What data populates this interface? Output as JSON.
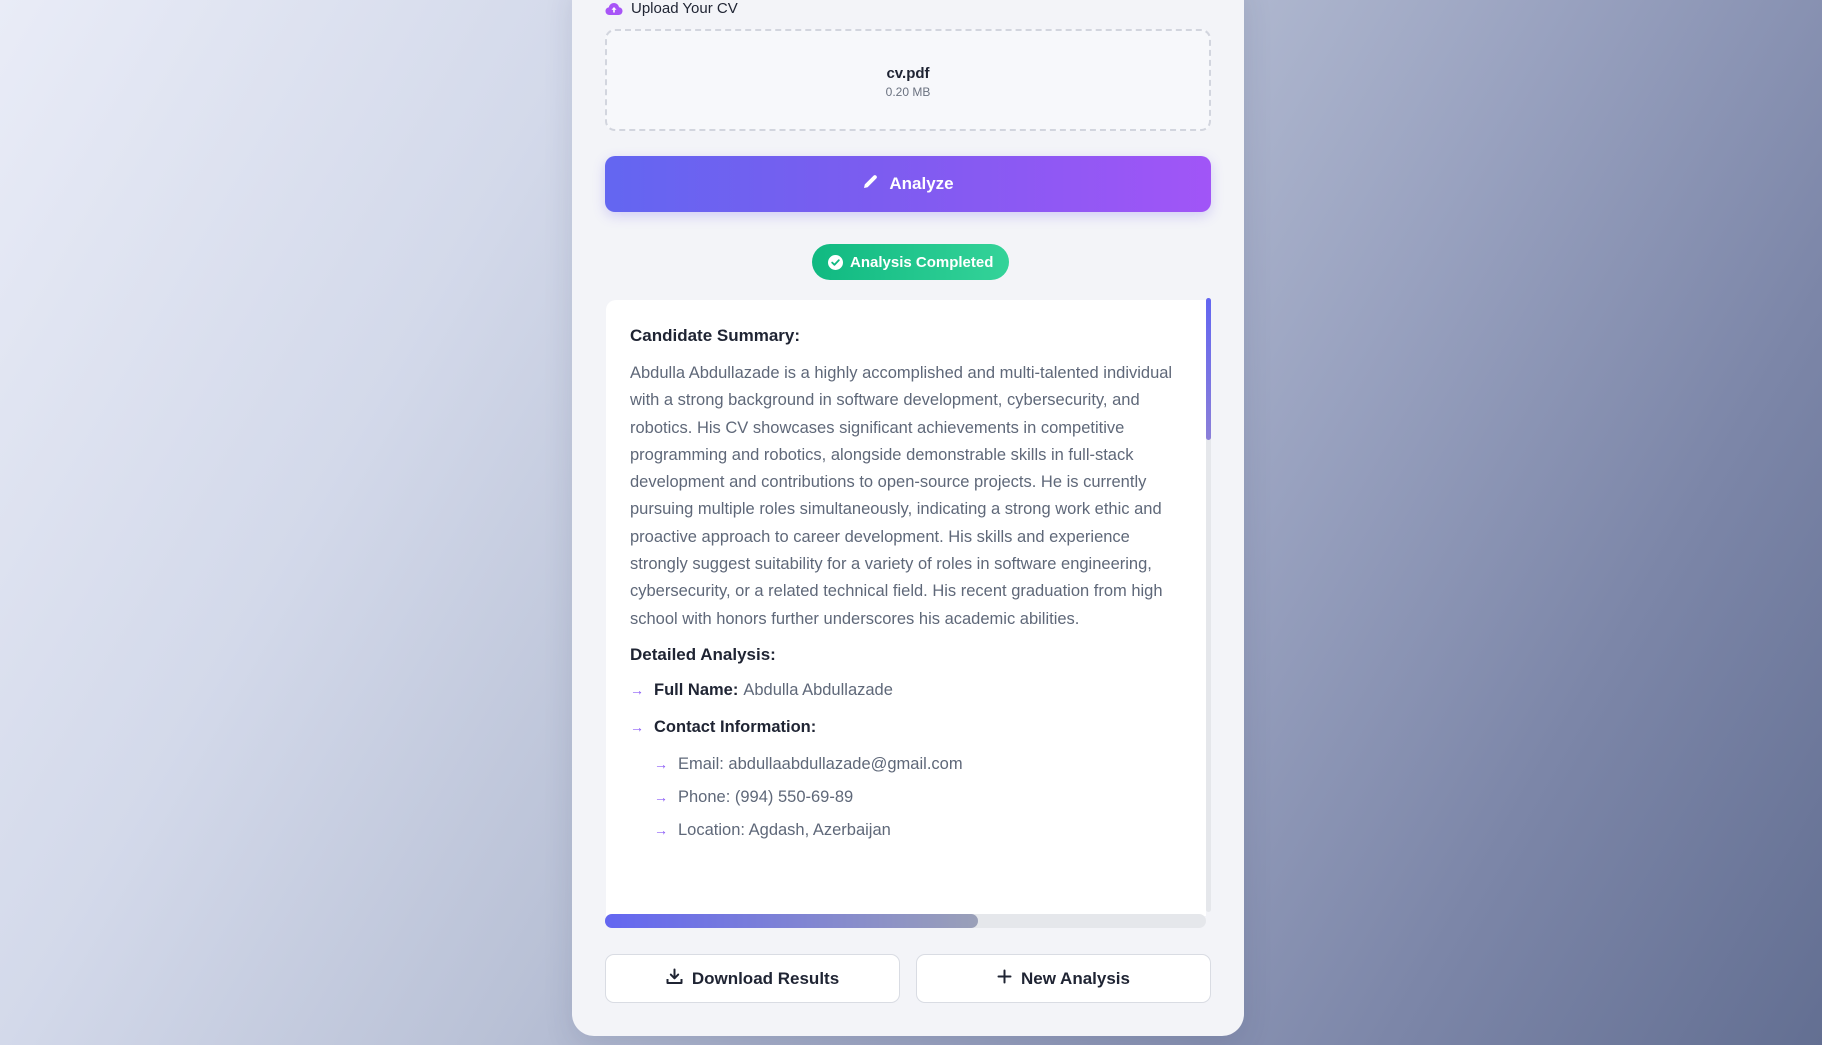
{
  "upload": {
    "title": "Upload Your CV",
    "icon": "cloud-upload-icon",
    "file_name": "cv.pdf",
    "file_size": "0.20 MB"
  },
  "analyze_button": {
    "label": "Analyze",
    "icon": "pencil-icon"
  },
  "status": {
    "label": "Analysis Completed",
    "icon": "check-circle-icon",
    "color": "#10b981"
  },
  "results": {
    "summary_title": "Candidate Summary:",
    "summary_text": "Abdulla Abdullazade is a highly accomplished and multi-talented individual with a strong background in software development, cybersecurity, and robotics. His CV showcases significant achievements in competitive programming and robotics, alongside demonstrable skills in full-stack development and contributions to open-source projects. He is currently pursuing multiple roles simultaneously, indicating a strong work ethic and proactive approach to career development. His skills and experience strongly suggest suitability for a variety of roles in software engineering, cybersecurity, or a related technical field. His recent graduation from high school with honors further underscores his academic abilities.",
    "detail_title": "Detailed Analysis:",
    "full_name_key": "Full Name:",
    "full_name_value": "Abdulla Abdullazade",
    "contact_key": "Contact Information:",
    "contact_items": [
      "Email: abdullaabdullazade@gmail.com",
      "Phone: (994) 550-69-89",
      "Location: Agdash, Azerbaijan"
    ],
    "arrow": "→"
  },
  "scroll": {
    "vertical_fraction": 0.23,
    "horizontal_fraction": 0.62
  },
  "actions": {
    "download_label": "Download Results",
    "download_icon": "download-icon",
    "new_label": "New Analysis",
    "new_icon": "plus-icon"
  },
  "colors": {
    "accent": "#6366f1",
    "accent2": "#a155f7",
    "success": "#10b981"
  }
}
